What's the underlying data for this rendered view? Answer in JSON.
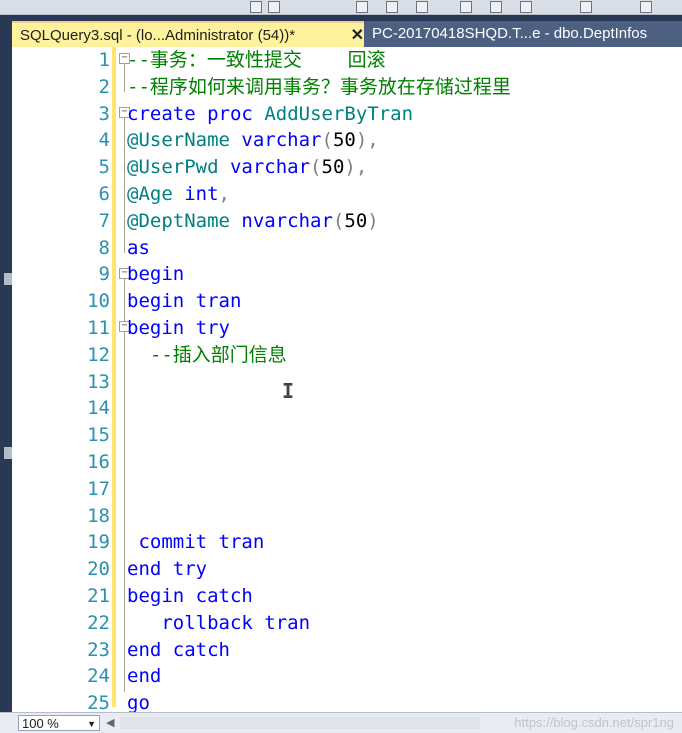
{
  "tabs": {
    "active_title": "SQLQuery3.sql - (lo...Administrator (54))*",
    "close_glyph": "✕",
    "inactive_title": "PC-20170418SHQD.T...e - dbo.DeptInfos"
  },
  "editor": {
    "line_numbers": [
      "1",
      "2",
      "3",
      "4",
      "5",
      "6",
      "7",
      "8",
      "9",
      "10",
      "11",
      "12",
      "13",
      "14",
      "15",
      "16",
      "17",
      "18",
      "19",
      "20",
      "21",
      "22",
      "23",
      "24",
      "25"
    ],
    "lines": [
      "--事务：一致性提交    回滚",
      "--程序如何来调用事务？事务放在存储过程里",
      "create proc AddUserByTran",
      "@UserName varchar(50),",
      "@UserPwd varchar(50),",
      "@Age int,",
      "@DeptName nvarchar(50)",
      "as",
      "begin",
      "begin tran",
      "begin try",
      "  --插入部门信息",
      "",
      "",
      "",
      "",
      "",
      "",
      " commit tran",
      "end try",
      "begin catch",
      "   rollback tran",
      "end catch",
      "end",
      "go"
    ],
    "colors": {
      "keyword": "#0000ff",
      "variable": "#008080",
      "punctuation": "#808080",
      "comment": "#008000",
      "line_number": "#2b91af",
      "change_bar": "#ffe56b"
    }
  },
  "statusbar": {
    "zoom": "100 %",
    "zoom_arrow": "▼",
    "scroll_left_glyph": "◀",
    "watermark": "https://blog.csdn.net/spr1ng"
  }
}
